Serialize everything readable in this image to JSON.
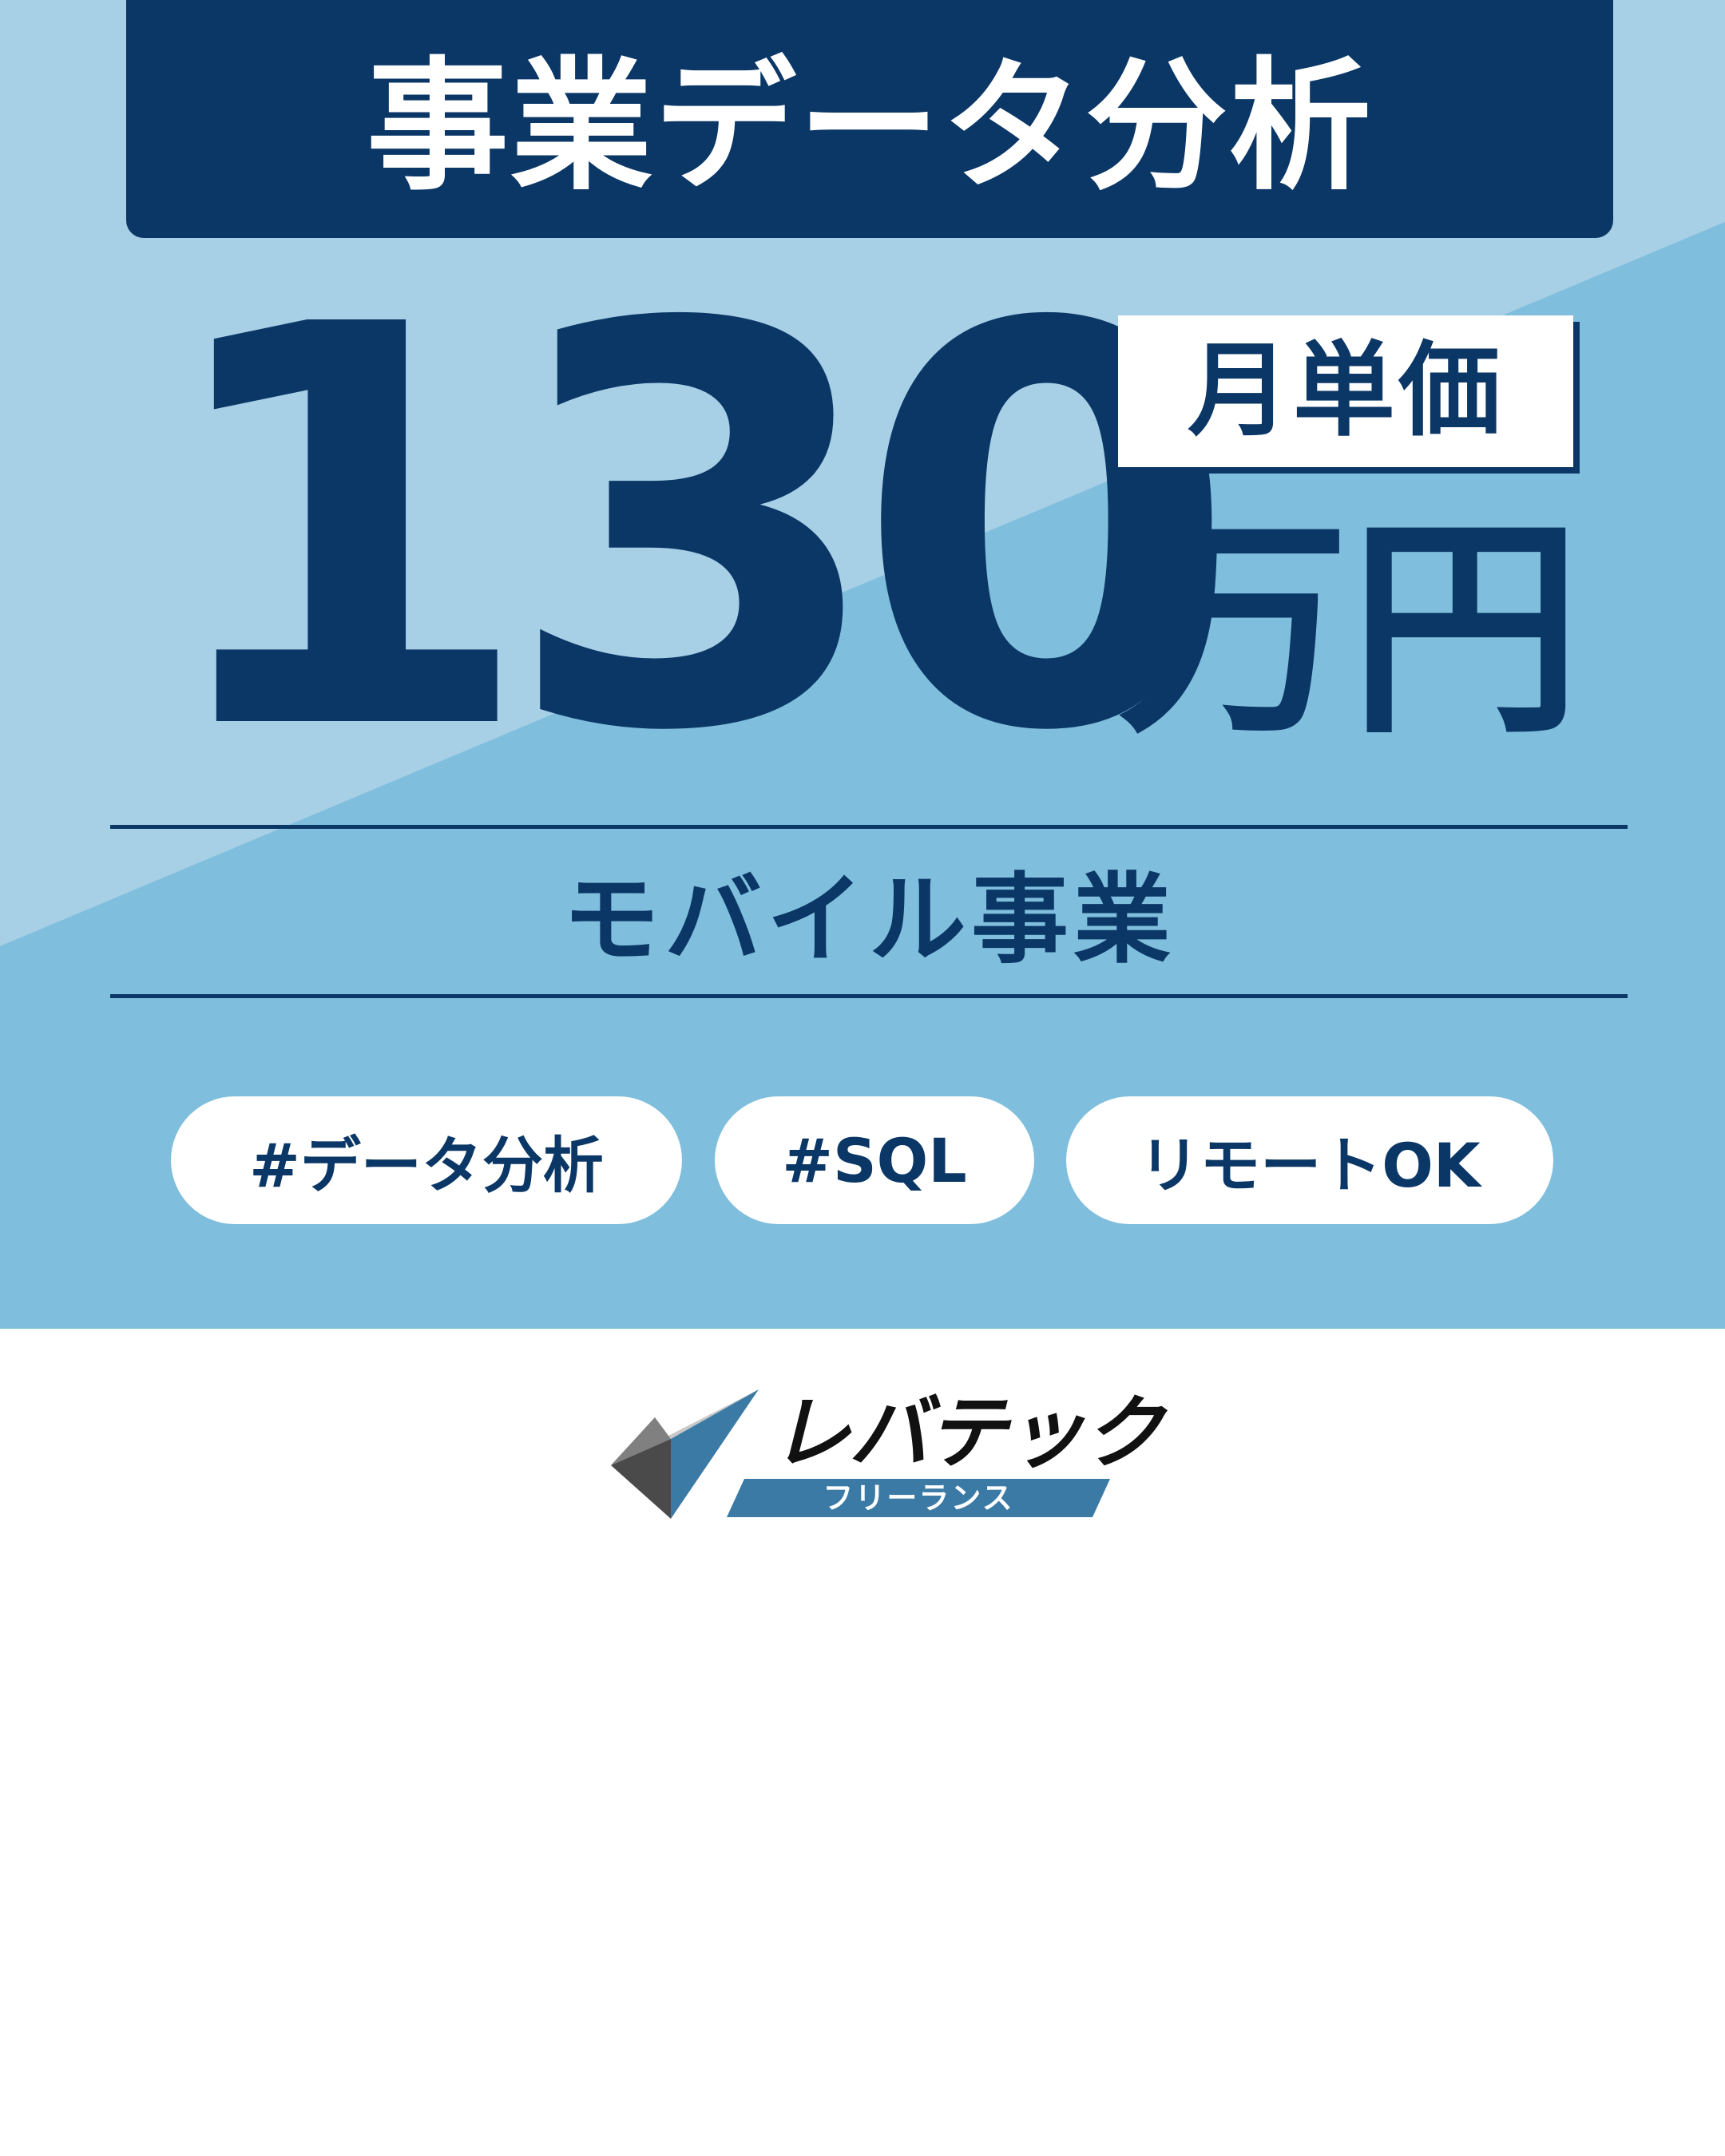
{
  "title": "事業データ分析",
  "price": {
    "amount": "130",
    "label": "月単価",
    "unit": "万円"
  },
  "sector": "モバイル事業",
  "tags": [
    "#データ分析",
    "#SQL",
    "リモートOK"
  ],
  "brand": {
    "name": "レバテック",
    "sub": "フリーランス"
  },
  "colors": {
    "navy": "#0b3766",
    "sky_light": "#a7cfe6",
    "sky": "#7fbedc",
    "logo_band": "#3c7aa6"
  }
}
